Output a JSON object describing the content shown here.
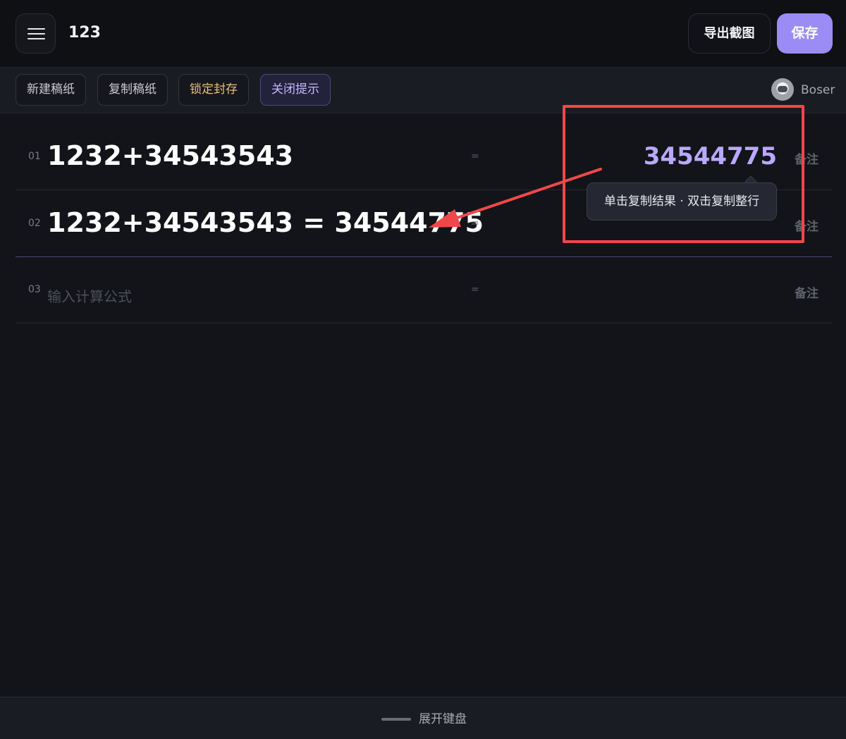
{
  "header": {
    "title": "123",
    "export_label": "导出截图",
    "save_label": "保存"
  },
  "toolbar": {
    "new_sheet": "新建稿纸",
    "copy_sheet": "复制稿纸",
    "lock_archive": "锁定封存",
    "close_hints": "关闭提示"
  },
  "user": {
    "name": "Boser"
  },
  "rows": [
    {
      "index": "01",
      "expression": "1232+34543543",
      "equals": "=",
      "result": "34544775",
      "note": "备注"
    },
    {
      "index": "02",
      "expression": "1232+34543543 = 34544775",
      "equals": "=",
      "result": "",
      "note": "备注"
    },
    {
      "index": "03",
      "expression": "",
      "placeholder": "输入计算公式",
      "equals": "=",
      "result": "",
      "note": "备注"
    }
  ],
  "tooltip": {
    "text": "单击复制结果 · 双击复制整行"
  },
  "footer": {
    "expand_keyboard": "展开键盘"
  },
  "colors": {
    "accent": "#9b8cf5",
    "result": "#b9a8ff",
    "lock": "#e6c07a",
    "annotation": "#f0474b"
  }
}
